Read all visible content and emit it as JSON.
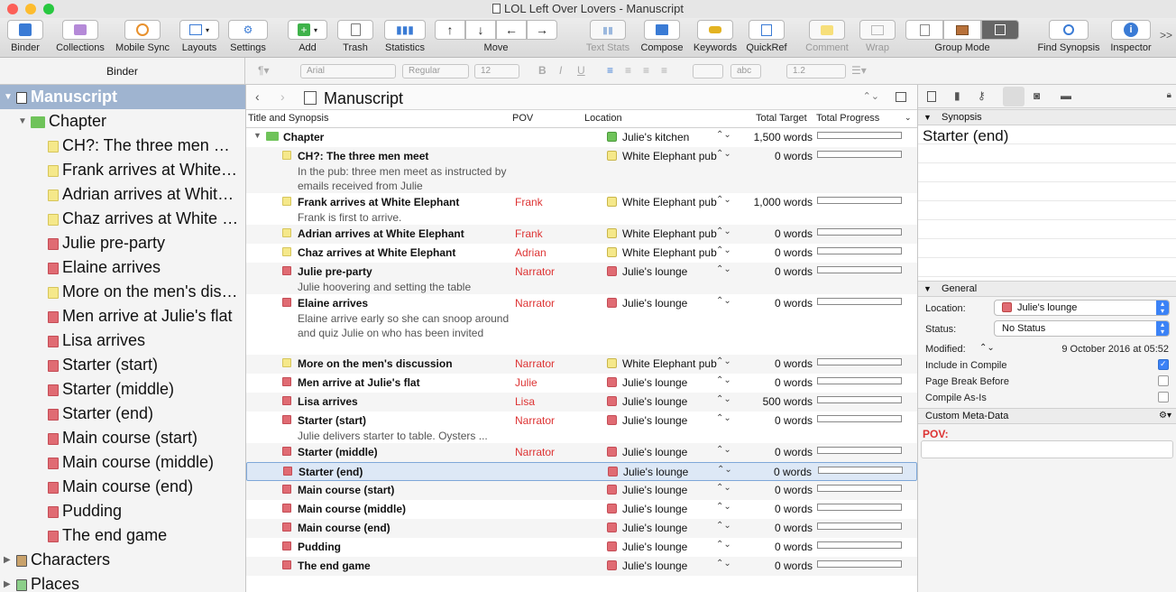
{
  "window": {
    "title": "LOL Left Over Lovers - Manuscript"
  },
  "toolbar": {
    "binder": "Binder",
    "collections": "Collections",
    "mobile_sync": "Mobile Sync",
    "layouts": "Layouts",
    "settings": "Settings",
    "add": "Add",
    "trash": "Trash",
    "statistics": "Statistics",
    "move": "Move",
    "text_stats": "Text Stats",
    "compose": "Compose",
    "keywords": "Keywords",
    "quickref": "QuickRef",
    "comment": "Comment",
    "wrap": "Wrap",
    "group_mode": "Group Mode",
    "find_synopsis": "Find Synopsis",
    "inspector": "Inspector",
    "overflow": ">>"
  },
  "format": {
    "binder_label": "Binder",
    "font": "Arial",
    "style": "Regular",
    "size": "12",
    "abc": "abc",
    "spacing": "1.2"
  },
  "binder": {
    "items": [
      {
        "label": "Manuscript"
      },
      {
        "label": "Chapter"
      },
      {
        "label": "CH?: The three men meet"
      },
      {
        "label": "Frank arrives at White Elephant"
      },
      {
        "label": "Adrian arrives at White Elephant"
      },
      {
        "label": "Chaz arrives at White Elephant"
      },
      {
        "label": "Julie pre-party"
      },
      {
        "label": "Elaine arrives"
      },
      {
        "label": "More on the men's discussion"
      },
      {
        "label": "Men arrive at Julie's flat"
      },
      {
        "label": "Lisa arrives"
      },
      {
        "label": "Starter (start)"
      },
      {
        "label": "Starter (middle)"
      },
      {
        "label": "Starter (end)"
      },
      {
        "label": "Main course (start)"
      },
      {
        "label": "Main course (middle)"
      },
      {
        "label": "Main course (end)"
      },
      {
        "label": "Pudding"
      },
      {
        "label": "The end game"
      },
      {
        "label": "Characters"
      },
      {
        "label": "Places"
      }
    ]
  },
  "editor": {
    "title": "Manuscript",
    "columns": {
      "title": "Title and Synopsis",
      "pov": "POV",
      "location": "Location",
      "target": "Total Target",
      "progress": "Total Progress"
    },
    "rows": [
      {
        "title": "Chapter",
        "synopsis": "",
        "pov": "",
        "location": "Julie's kitchen",
        "target": "1,500 words"
      },
      {
        "title": "CH?: The three men meet",
        "synopsis": "In the pub: three men meet as instructed by emails received from Julie",
        "pov": "",
        "location": "White Elephant pub",
        "target": "0 words"
      },
      {
        "title": "Frank arrives at White Elephant",
        "synopsis": "Frank is first to arrive.",
        "pov": "Frank",
        "location": "White Elephant pub",
        "target": "1,000 words"
      },
      {
        "title": "Adrian arrives at White Elephant",
        "synopsis": "",
        "pov": "Frank",
        "location": "White Elephant pub",
        "target": "0 words"
      },
      {
        "title": "Chaz arrives at White Elephant",
        "synopsis": "",
        "pov": "Adrian",
        "location": "White Elephant pub",
        "target": "0 words"
      },
      {
        "title": "Julie pre-party",
        "synopsis": "Julie hoovering and setting the table",
        "pov": "Narrator",
        "location": "Julie's lounge",
        "target": "0 words"
      },
      {
        "title": "Elaine arrives",
        "synopsis": "Elaine arrive early so she can snoop around and quiz Julie on who has been invited",
        "pov": "Narrator",
        "location": "Julie's lounge",
        "target": "0 words"
      },
      {
        "title": "More on the men's discussion",
        "synopsis": "",
        "pov": "Narrator",
        "location": "White Elephant pub",
        "target": "0 words"
      },
      {
        "title": "Men arrive at Julie's flat",
        "synopsis": "",
        "pov": "Julie",
        "location": "Julie's lounge",
        "target": "0 words"
      },
      {
        "title": "Lisa arrives",
        "synopsis": "",
        "pov": "Lisa",
        "location": "Julie's lounge",
        "target": "500 words"
      },
      {
        "title": "Starter (start)",
        "synopsis": "Julie delivers starter to table. Oysters ...",
        "pov": "Narrator",
        "location": "Julie's lounge",
        "target": "0 words"
      },
      {
        "title": "Starter (middle)",
        "synopsis": "",
        "pov": "Narrator",
        "location": "Julie's lounge",
        "target": "0 words"
      },
      {
        "title": "Starter (end)",
        "synopsis": "",
        "pov": "",
        "location": "Julie's lounge",
        "target": "0 words"
      },
      {
        "title": "Main course (start)",
        "synopsis": "",
        "pov": "",
        "location": "Julie's lounge",
        "target": "0 words"
      },
      {
        "title": "Main course (middle)",
        "synopsis": "",
        "pov": "",
        "location": "Julie's lounge",
        "target": "0 words"
      },
      {
        "title": "Main course (end)",
        "synopsis": "",
        "pov": "",
        "location": "Julie's lounge",
        "target": "0 words"
      },
      {
        "title": "Pudding",
        "synopsis": "",
        "pov": "",
        "location": "Julie's lounge",
        "target": "0 words"
      },
      {
        "title": "The end game",
        "synopsis": "",
        "pov": "",
        "location": "Julie's lounge",
        "target": "0 words"
      }
    ]
  },
  "inspector": {
    "synopsis_header": "Synopsis",
    "synopsis_title": "Starter (end)",
    "general_header": "General",
    "location_label": "Location:",
    "location_value": "Julie's lounge",
    "status_label": "Status:",
    "status_value": "No Status",
    "modified_label": "Modified:",
    "modified_value": "9 October 2016 at 05:52",
    "include_compile": "Include in Compile",
    "page_break": "Page Break Before",
    "compile_as_is": "Compile As-Is",
    "meta_header": "Custom Meta-Data",
    "pov_label": "POV:"
  },
  "colors": {
    "green": "#6fc35a",
    "yellow": "#f5e88a",
    "red": "#e06b73",
    "selection": "#9fb4d0"
  }
}
